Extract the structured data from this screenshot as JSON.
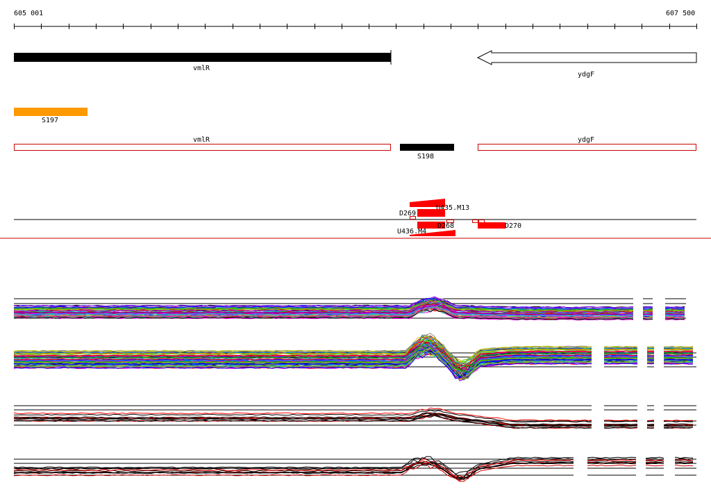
{
  "ruler": {
    "start_label": "605 001",
    "end_label": "607 500"
  },
  "genes": [
    {
      "id": "vmlR",
      "label": "vmlR",
      "strand": "+",
      "color": "#000000",
      "filled": true
    },
    {
      "id": "ydgF",
      "label": "ydgF",
      "strand": "-",
      "color": "#000000",
      "filled": false
    }
  ],
  "segments": [
    {
      "id": "S197",
      "label": "S197",
      "color": "#ff9900"
    },
    {
      "id": "S198",
      "label": "S198",
      "color": "#000000"
    }
  ],
  "outline_genes": [
    {
      "id": "vmlR-outline",
      "label": "vmlR",
      "color": "#cc0000"
    },
    {
      "id": "ydgF-outline",
      "label": "ydgF",
      "color": "#cc0000"
    }
  ],
  "features": [
    {
      "id": "D269",
      "label": "D269"
    },
    {
      "id": "U435.M13",
      "label": "U435.M13"
    },
    {
      "id": "D268",
      "label": "D268"
    },
    {
      "id": "U436.M4",
      "label": "U436.M4"
    },
    {
      "id": "D270",
      "label": "D270"
    }
  ],
  "colors": {
    "feature_red": "#ff0000",
    "divider": "#cc0000",
    "track_line": "#000000"
  },
  "expression_panels": [
    {
      "id": "panel-1",
      "kind": "multi-color"
    },
    {
      "id": "panel-2",
      "kind": "multi-color"
    },
    {
      "id": "panel-3",
      "kind": "red-black"
    },
    {
      "id": "panel-4",
      "kind": "red-black"
    }
  ]
}
